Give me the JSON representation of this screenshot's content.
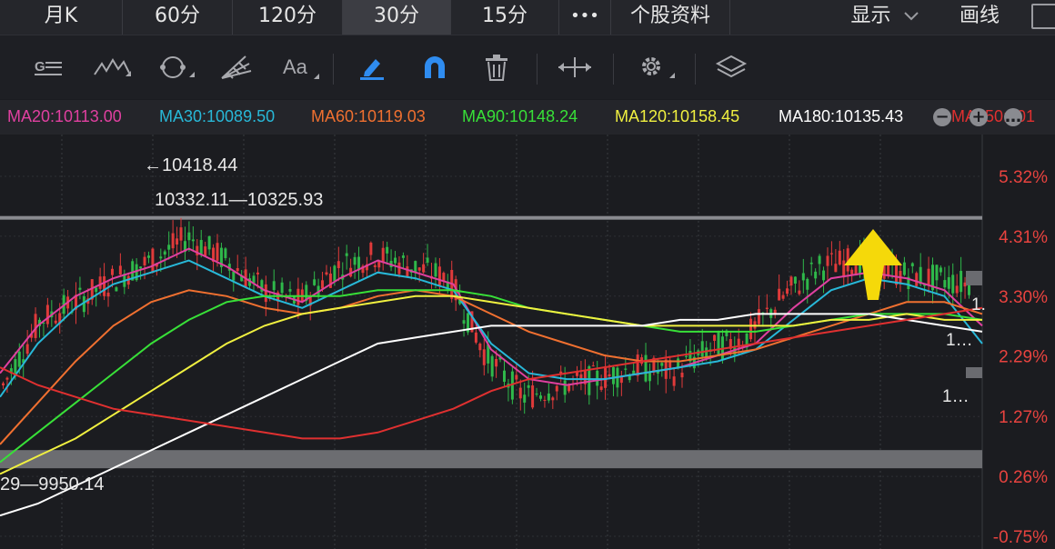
{
  "tabs": [
    {
      "label": "月K",
      "active": false
    },
    {
      "label": "60分",
      "active": false
    },
    {
      "label": "120分",
      "active": false
    },
    {
      "label": "30分",
      "active": true
    },
    {
      "label": "15分",
      "active": false
    },
    {
      "label": "•••",
      "active": false
    },
    {
      "label": "个股资料",
      "active": false
    }
  ],
  "header_right": {
    "display_label": "显示",
    "draw_label": "画线"
  },
  "toolbar_icons": [
    "gauge-text-icon",
    "wave-icon",
    "cycle-icon",
    "fibonacci-fan-icon",
    "text-tool-icon",
    "pen-icon",
    "magnet-icon",
    "trash-icon",
    "horizontal-arrows-icon",
    "settings-icon",
    "layers-icon"
  ],
  "ma_legend": [
    {
      "label": "MA20:10113.00",
      "color": "#e040a0"
    },
    {
      "label": "MA30:10089.50",
      "color": "#28b8d8"
    },
    {
      "label": "MA60:10119.03",
      "color": "#f07030"
    },
    {
      "label": "MA90:10148.24",
      "color": "#38e038"
    },
    {
      "label": "MA120:10158.45",
      "color": "#f0f040"
    },
    {
      "label": "MA180:10135.43",
      "color": "#ffffff"
    },
    {
      "label": "MA250:101",
      "color": "#e03030"
    }
  ],
  "annotations": {
    "high_label": "←10418.44",
    "resistance_label": "10332.11—10325.93",
    "support_label": "29—9950.14",
    "right_tag_1": "1.",
    "right_tag_2": "1…",
    "right_tag_3": "1…"
  },
  "chart_data": {
    "type": "line",
    "x": [
      "1",
      "2",
      "3",
      "4",
      "5",
      "6",
      "7",
      "8",
      "9",
      "10",
      "11",
      "12",
      "13",
      "14",
      "15",
      "16",
      "17",
      "18",
      "19",
      "20",
      "21",
      "22",
      "23",
      "24",
      "25",
      "26",
      "27"
    ],
    "y_axis_labels": [
      "5.32%",
      "4.31%",
      "3.30%",
      "2.29%",
      "1.27%",
      "0.26%",
      "-0.75%"
    ],
    "y_axis_values": [
      5.32,
      4.31,
      3.3,
      2.29,
      1.27,
      0.26,
      -0.75
    ],
    "ylim": [
      -0.75,
      5.32
    ],
    "grid": true,
    "price_series": [
      1.8,
      2.9,
      3.2,
      3.6,
      3.9,
      4.3,
      3.9,
      3.4,
      3.2,
      3.8,
      4.0,
      3.8,
      3.6,
      2.3,
      1.6,
      1.8,
      1.9,
      2.1,
      2.0,
      2.4,
      2.6,
      3.3,
      3.8,
      3.9,
      3.7,
      3.6,
      3.5
    ],
    "highlight_bands": [
      {
        "name": "resistance",
        "value": 4.62
      },
      {
        "name": "support",
        "value": 0.55
      }
    ],
    "series": [
      {
        "name": "MA20",
        "color": "#e040a0",
        "values": [
          2.0,
          2.8,
          3.3,
          3.6,
          3.8,
          4.1,
          3.8,
          3.4,
          3.2,
          3.6,
          3.9,
          3.7,
          3.5,
          2.4,
          1.9,
          1.8,
          1.9,
          2.0,
          2.1,
          2.3,
          2.5,
          3.1,
          3.6,
          3.7,
          3.6,
          3.4,
          2.8
        ]
      },
      {
        "name": "MA30",
        "color": "#28b8d8",
        "values": [
          1.6,
          2.5,
          3.1,
          3.5,
          3.7,
          3.9,
          3.6,
          3.3,
          3.1,
          3.4,
          3.7,
          3.6,
          3.4,
          2.5,
          2.0,
          1.9,
          1.9,
          2.0,
          2.1,
          2.2,
          2.4,
          2.9,
          3.4,
          3.6,
          3.5,
          3.3,
          2.5
        ]
      },
      {
        "name": "MA60",
        "color": "#f07030",
        "values": [
          0.8,
          1.5,
          2.2,
          2.8,
          3.2,
          3.4,
          3.3,
          3.1,
          3.0,
          3.1,
          3.3,
          3.4,
          3.3,
          3.0,
          2.7,
          2.5,
          2.3,
          2.2,
          2.2,
          2.3,
          2.4,
          2.6,
          2.8,
          3.0,
          3.2,
          3.2,
          3.0
        ]
      },
      {
        "name": "MA90",
        "color": "#38e038",
        "values": [
          0.5,
          1.0,
          1.5,
          2.0,
          2.5,
          2.9,
          3.2,
          3.3,
          3.3,
          3.3,
          3.4,
          3.4,
          3.4,
          3.3,
          3.1,
          3.0,
          2.9,
          2.8,
          2.7,
          2.7,
          2.7,
          2.8,
          2.9,
          3.0,
          3.0,
          3.0,
          2.9
        ]
      },
      {
        "name": "MA120",
        "color": "#f0f040",
        "values": [
          0.3,
          0.6,
          0.9,
          1.3,
          1.7,
          2.1,
          2.5,
          2.8,
          3.0,
          3.1,
          3.2,
          3.3,
          3.3,
          3.2,
          3.1,
          3.0,
          2.9,
          2.8,
          2.8,
          2.8,
          2.8,
          2.8,
          2.9,
          2.9,
          3.0,
          2.9,
          2.9
        ]
      },
      {
        "name": "MA180",
        "color": "#ffffff",
        "values": [
          -0.4,
          -0.2,
          0.1,
          0.4,
          0.7,
          1.0,
          1.3,
          1.6,
          1.9,
          2.2,
          2.5,
          2.6,
          2.7,
          2.8,
          2.8,
          2.8,
          2.8,
          2.8,
          2.9,
          2.9,
          3.0,
          3.0,
          3.0,
          3.0,
          2.9,
          2.8,
          2.7
        ]
      },
      {
        "name": "MA250",
        "color": "#e03030",
        "values": [
          2.1,
          1.8,
          1.6,
          1.4,
          1.3,
          1.2,
          1.1,
          1.0,
          0.9,
          0.9,
          1.0,
          1.2,
          1.4,
          1.7,
          1.9,
          2.0,
          2.1,
          2.2,
          2.3,
          2.4,
          2.5,
          2.6,
          2.7,
          2.8,
          2.9,
          3.0,
          3.1
        ]
      }
    ]
  }
}
